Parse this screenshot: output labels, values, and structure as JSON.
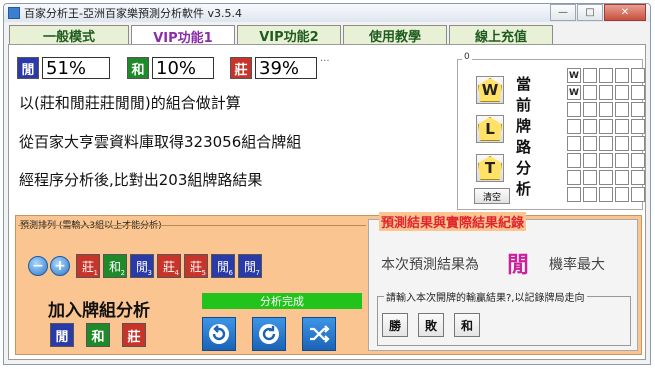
{
  "window": {
    "title": "百家分析王-亞洲百家樂預測分析軟件 v3.5.4",
    "controls": {
      "minimize": "—",
      "maximize": "□",
      "close": "✕"
    }
  },
  "tabs": [
    {
      "label": "一般模式",
      "active": false
    },
    {
      "label": "VIP功能1",
      "active": true
    },
    {
      "label": "VIP功能2",
      "active": false
    },
    {
      "label": "使用教學",
      "active": false
    },
    {
      "label": "線上充值",
      "active": false
    }
  ],
  "stats": {
    "player": {
      "glyph": "閒",
      "value": "51%",
      "color": "#2a3aa8"
    },
    "tie": {
      "glyph": "和",
      "value": "10%",
      "color": "#1f8a2a"
    },
    "banker": {
      "glyph": "莊",
      "value": "39%",
      "color": "#c8342a"
    },
    "dots": "..."
  },
  "info_lines": [
    "以(莊和閒莊莊閒閒)的組合做計算",
    "從百家大亨雲資料庫取得323056組合牌組",
    "經程序分析後,比對出203組牌路結果"
  ],
  "road_panel": {
    "label": "0",
    "title_chars": [
      "當",
      "前",
      "牌",
      "路",
      "分",
      "析"
    ],
    "buttons": [
      "W",
      "L",
      "T"
    ],
    "clear_label": "清空",
    "grid": [
      [
        "W",
        "",
        "",
        "",
        ""
      ],
      [
        "W",
        "",
        "",
        "",
        ""
      ],
      [
        "",
        "",
        "",
        "",
        ""
      ],
      [
        "",
        "",
        "",
        "",
        ""
      ],
      [
        "",
        "",
        "",
        "",
        ""
      ],
      [
        "",
        "",
        "",
        "",
        ""
      ],
      [
        "",
        "",
        "",
        "",
        ""
      ],
      [
        "",
        "",
        "",
        "",
        ""
      ]
    ]
  },
  "predict_section": {
    "header": "預測排列 (需輸入3組以上才能分析)",
    "sequence": [
      {
        "glyph": "莊",
        "index": "1",
        "color": "#c8342a"
      },
      {
        "glyph": "和",
        "index": "2",
        "color": "#1f8a2a"
      },
      {
        "glyph": "閒",
        "index": "3",
        "color": "#2a3aa8"
      },
      {
        "glyph": "莊",
        "index": "4",
        "color": "#c8342a"
      },
      {
        "glyph": "莊",
        "index": "5",
        "color": "#c8342a"
      },
      {
        "glyph": "閒",
        "index": "6",
        "color": "#2a3aa8"
      },
      {
        "glyph": "閒",
        "index": "7",
        "color": "#2a3aa8"
      }
    ],
    "add_label": "加入牌組分析",
    "add_buttons": [
      {
        "glyph": "閒",
        "color": "#2a3aa8"
      },
      {
        "glyph": "和",
        "color": "#1f8a2a"
      },
      {
        "glyph": "莊",
        "color": "#c8342a"
      }
    ],
    "status": "分析完成",
    "controls": [
      "undo-icon",
      "refresh-icon",
      "shuffle-icon"
    ]
  },
  "result_section": {
    "title": "預測結果與實際結果紀錄",
    "prediction_prefix": "本次預測結果為",
    "prediction_value": "閒",
    "prediction_suffix": "機率最大",
    "input_legend": "請輸入本次開牌的輸贏結果?,以記錄牌局走向",
    "choices": [
      "勝",
      "敗",
      "和"
    ]
  },
  "colors": {
    "tab_active_text": "#8a2ca8",
    "tab_text": "#1f5c1f",
    "accent_red": "#e0252f",
    "accent_magenta": "#cc1f9e",
    "status_green": "#22c41c"
  }
}
